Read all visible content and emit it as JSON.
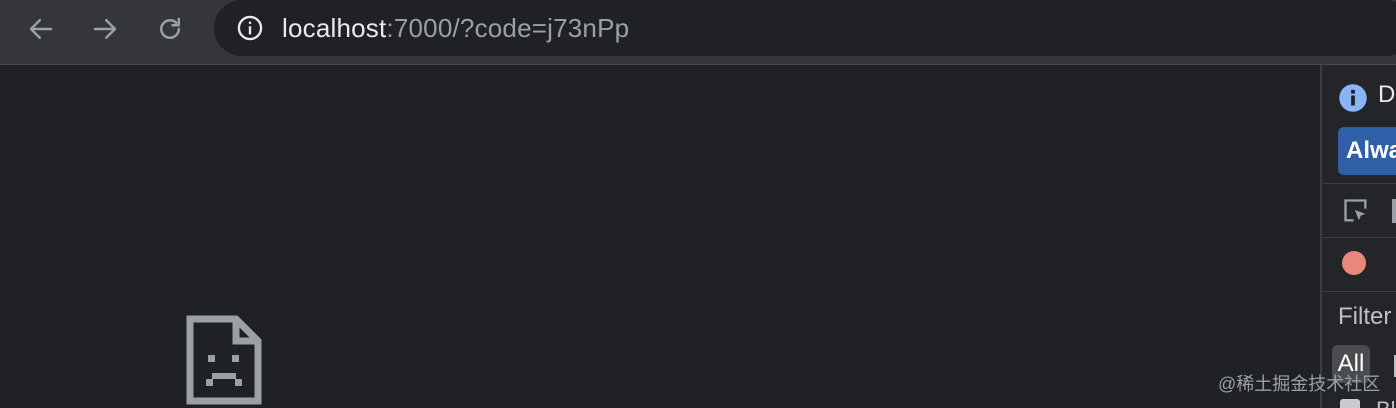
{
  "browser": {
    "url_host": "localhost",
    "url_rest": ":7000/?code=j73nPp",
    "back_icon": "arrow-left-icon",
    "forward_icon": "arrow-right-icon",
    "reload_icon": "reload-icon",
    "site_info_icon": "info-circle-icon"
  },
  "page": {
    "error_icon": "sad-file-icon"
  },
  "devtools": {
    "info_text": "D",
    "always_button": "Alwa",
    "filter_label": "Filter",
    "all_chip": "All",
    "checkbox_text": "Bl",
    "record_color": "#e8887c",
    "accent_color": "#2f5fa7"
  },
  "watermark": "@稀土掘金技术社区"
}
